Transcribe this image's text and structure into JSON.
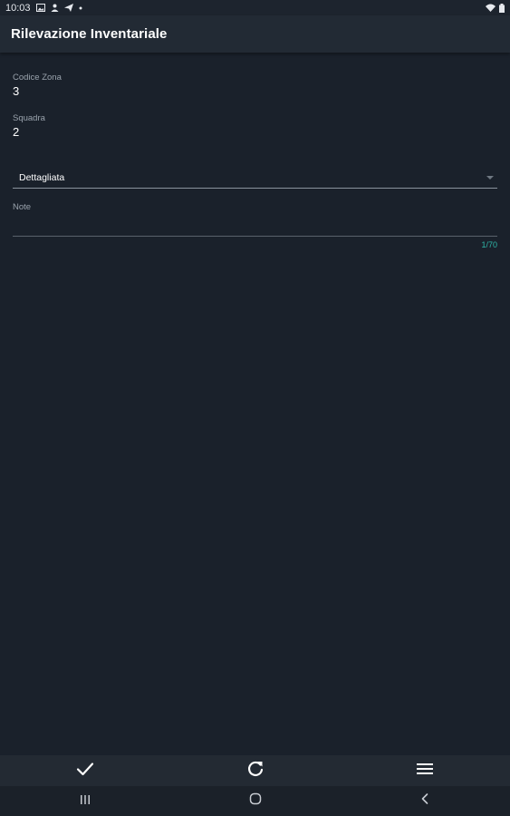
{
  "status_bar": {
    "time": "10:03",
    "icons": [
      "image-icon",
      "person-icon",
      "send-icon",
      "dot-icon"
    ],
    "right_icons": [
      "wifi-icon",
      "battery-icon"
    ]
  },
  "app_bar": {
    "title": "Rilevazione Inventariale"
  },
  "form": {
    "zone_code": {
      "label": "Codice Zona",
      "value": "3"
    },
    "team": {
      "label": "Squadra",
      "value": "2"
    },
    "mode_select": {
      "selected": "Dettagliata"
    },
    "notes": {
      "label": "Note",
      "value": "",
      "counter": "1/70"
    }
  },
  "bottom_toolbar": {
    "icons": [
      "check-icon",
      "refresh-icon",
      "menu-icon"
    ]
  },
  "nav_bar": {
    "icons": [
      "recent-apps-icon",
      "home-icon",
      "back-icon"
    ]
  },
  "colors": {
    "background": "#1a212b",
    "app_bar": "#222a34",
    "accent": "#2fb6a8",
    "label": "#9aa3ad"
  }
}
